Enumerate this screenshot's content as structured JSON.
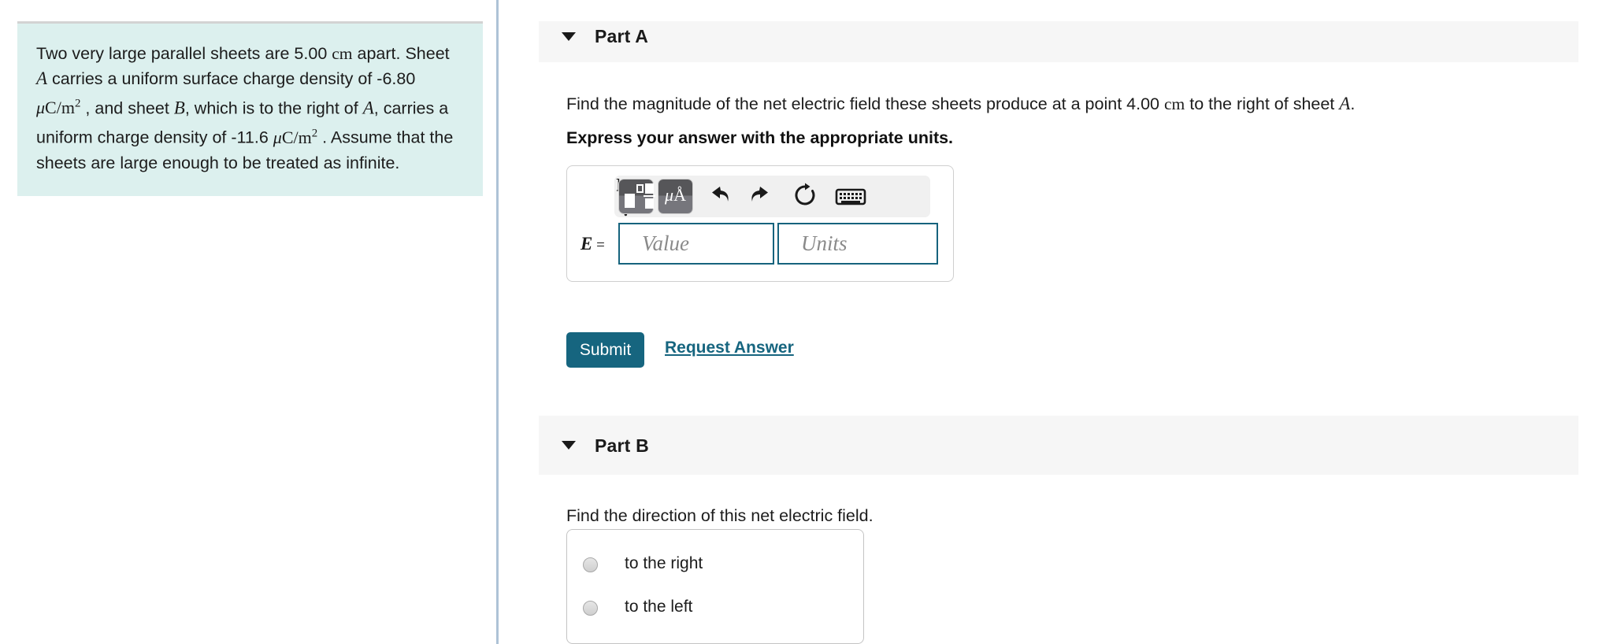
{
  "problem": {
    "line1_pre": "Two very large parallel sheets are 5.00 ",
    "unit_cm": "cm",
    "line1_post": " apart. Sheet ",
    "sheet_a": "A",
    "line2": " carries a uniform surface charge density of -6.80 ",
    "density_unit_mu": "μ",
    "density_unit_c_m": "C/m",
    "density_unit_exp": "2",
    "line3": " , and sheet ",
    "sheet_b": "B",
    "line4": ", which is to the right of ",
    "sheet_a2": "A",
    "line5": ", carries a uniform charge density of -11.6 ",
    "line6": " . Assume that the sheets are large enough to be treated as infinite.",
    "full_text": "Two very large parallel sheets are 5.00 cm apart. Sheet A carries a uniform surface charge density of -6.80 μC/m2 , and sheet B, which is to the right of A, carries a uniform charge density of -11.6 μC/m2 . Assume that the sheets are large enough to be treated as infinite."
  },
  "part_a": {
    "title": "Part A",
    "caret": "caret-down-icon",
    "question_pre": "Find the magnitude of the net electric field these sheets produce at a point 4.00 ",
    "question_unit": "cm",
    "question_mid": " to the right of sheet ",
    "question_sheet": "A",
    "question_end": ".",
    "instruction": "Express your answer with the appropriate units.",
    "answer_label_var": "E",
    "answer_label_eq": " =",
    "value_placeholder": "Value",
    "units_placeholder": "Units",
    "value_current": "",
    "units_current": "",
    "submit_label": "Submit",
    "request_answer_label": "Request Answer",
    "toolbar": {
      "template_button": "math-template-icon",
      "units_button_mu": "μ",
      "units_button_a": "Å",
      "undo": "undo-icon",
      "redo": "redo-icon",
      "reset": "reset-icon",
      "keyboard": "keyboard-icon",
      "bracket": "]",
      "help": "?"
    }
  },
  "part_b": {
    "title": "Part B",
    "caret": "caret-down-icon",
    "question": "Find the direction of this net electric field.",
    "choices": [
      {
        "label": "to the right",
        "selected": false
      },
      {
        "label": "to the left",
        "selected": false
      }
    ]
  },
  "colors": {
    "problem_background": "#dcf0ee",
    "part_header_background": "#f6f6f6",
    "accent_teal": "#16657f",
    "input_border": "#16637d",
    "divider": "#aec3d6",
    "toolbar_background": "#f0f0f0"
  }
}
